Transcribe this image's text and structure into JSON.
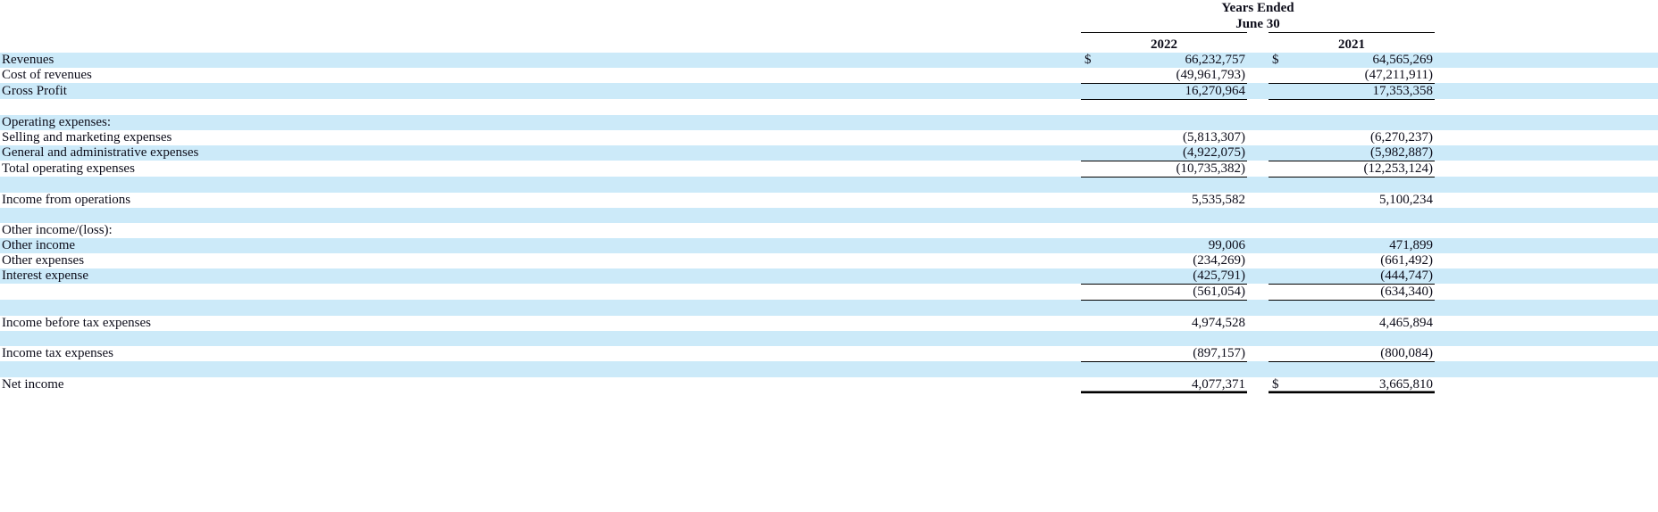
{
  "header": {
    "title_line1": "Years Ended",
    "title_line2": "June 30",
    "col1": "2022",
    "col2": "2021"
  },
  "currency_symbol": "$",
  "rows": [
    {
      "id": "revenues",
      "label": "Revenues",
      "indent": 0,
      "cur1": "$",
      "v1": "66,232,757",
      "cur2": "$",
      "v2": "64,565,269",
      "band": true
    },
    {
      "id": "cost-of-revenues",
      "label": "Cost of revenues",
      "indent": 0,
      "cur1": "",
      "v1": "(49,961,793)",
      "cur2": "",
      "v2": "(47,211,911)",
      "band": false,
      "rule_below": true
    },
    {
      "id": "gross-profit",
      "label": "Gross Profit",
      "indent": 0,
      "cur1": "",
      "v1": "16,270,964",
      "cur2": "",
      "v2": "17,353,358",
      "band": true,
      "rule_below": true
    },
    {
      "id": "spacer-1",
      "label": "",
      "indent": 0,
      "cur1": "",
      "v1": "",
      "cur2": "",
      "v2": "",
      "band": false
    },
    {
      "id": "operating-expenses-heading",
      "label": "Operating expenses:",
      "indent": 0,
      "cur1": "",
      "v1": "",
      "cur2": "",
      "v2": "",
      "band": true
    },
    {
      "id": "selling-and-marketing-expenses",
      "label": "Selling and marketing expenses",
      "indent": 1,
      "cur1": "",
      "v1": "(5,813,307)",
      "cur2": "",
      "v2": "(6,270,237)",
      "band": false
    },
    {
      "id": "general-and-administrative-expenses",
      "label": "General and administrative expenses",
      "indent": 1,
      "cur1": "",
      "v1": "(4,922,075)",
      "cur2": "",
      "v2": "(5,982,887)",
      "band": true,
      "rule_below": true
    },
    {
      "id": "total-operating-expenses",
      "label": "Total operating expenses",
      "indent": 0,
      "cur1": "",
      "v1": "(10,735,382)",
      "cur2": "",
      "v2": "(12,253,124)",
      "band": false,
      "rule_below": true
    },
    {
      "id": "spacer-2",
      "label": "",
      "indent": 0,
      "cur1": "",
      "v1": "",
      "cur2": "",
      "v2": "",
      "band": true
    },
    {
      "id": "income-from-operations",
      "label": "Income from operations",
      "indent": 0,
      "cur1": "",
      "v1": "5,535,582",
      "cur2": "",
      "v2": "5,100,234",
      "band": false
    },
    {
      "id": "spacer-3",
      "label": "",
      "indent": 0,
      "cur1": "",
      "v1": "",
      "cur2": "",
      "v2": "",
      "band": true
    },
    {
      "id": "other-income-loss-heading",
      "label": "Other income/(loss):",
      "indent": 0,
      "cur1": "",
      "v1": "",
      "cur2": "",
      "v2": "",
      "band": false
    },
    {
      "id": "other-income",
      "label": "Other income",
      "indent": 1,
      "cur1": "",
      "v1": "99,006",
      "cur2": "",
      "v2": "471,899",
      "band": true
    },
    {
      "id": "other-expenses",
      "label": "Other expenses",
      "indent": 1,
      "cur1": "",
      "v1": "(234,269)",
      "cur2": "",
      "v2": "(661,492)",
      "band": false
    },
    {
      "id": "interest-expense",
      "label": "Interest expense",
      "indent": 1,
      "cur1": "",
      "v1": "(425,791)",
      "cur2": "",
      "v2": "(444,747)",
      "band": true,
      "rule_below": true
    },
    {
      "id": "total-other-income-loss",
      "label": "",
      "indent": 0,
      "cur1": "",
      "v1": "(561,054)",
      "cur2": "",
      "v2": "(634,340)",
      "band": false,
      "rule_below": true
    },
    {
      "id": "spacer-4",
      "label": "",
      "indent": 0,
      "cur1": "",
      "v1": "",
      "cur2": "",
      "v2": "",
      "band": true
    },
    {
      "id": "income-before-tax-expenses",
      "label": "Income before tax expenses",
      "indent": 0,
      "cur1": "",
      "v1": "4,974,528",
      "cur2": "",
      "v2": "4,465,894",
      "band": false
    },
    {
      "id": "spacer-5",
      "label": "",
      "indent": 0,
      "cur1": "",
      "v1": "",
      "cur2": "",
      "v2": "",
      "band": true
    },
    {
      "id": "income-tax-expenses",
      "label": "Income tax expenses",
      "indent": 0,
      "cur1": "",
      "v1": "(897,157)",
      "cur2": "",
      "v2": "(800,084)",
      "band": false,
      "rule_below": true
    },
    {
      "id": "spacer-6",
      "label": "",
      "indent": 0,
      "cur1": "",
      "v1": "",
      "cur2": "",
      "v2": "",
      "band": true
    },
    {
      "id": "net-income",
      "label": "Net income",
      "indent": 0,
      "cur1": "",
      "v1": "4,077,371",
      "cur2": "$",
      "v2": "3,665,810",
      "band": false,
      "rule_double": true
    }
  ]
}
